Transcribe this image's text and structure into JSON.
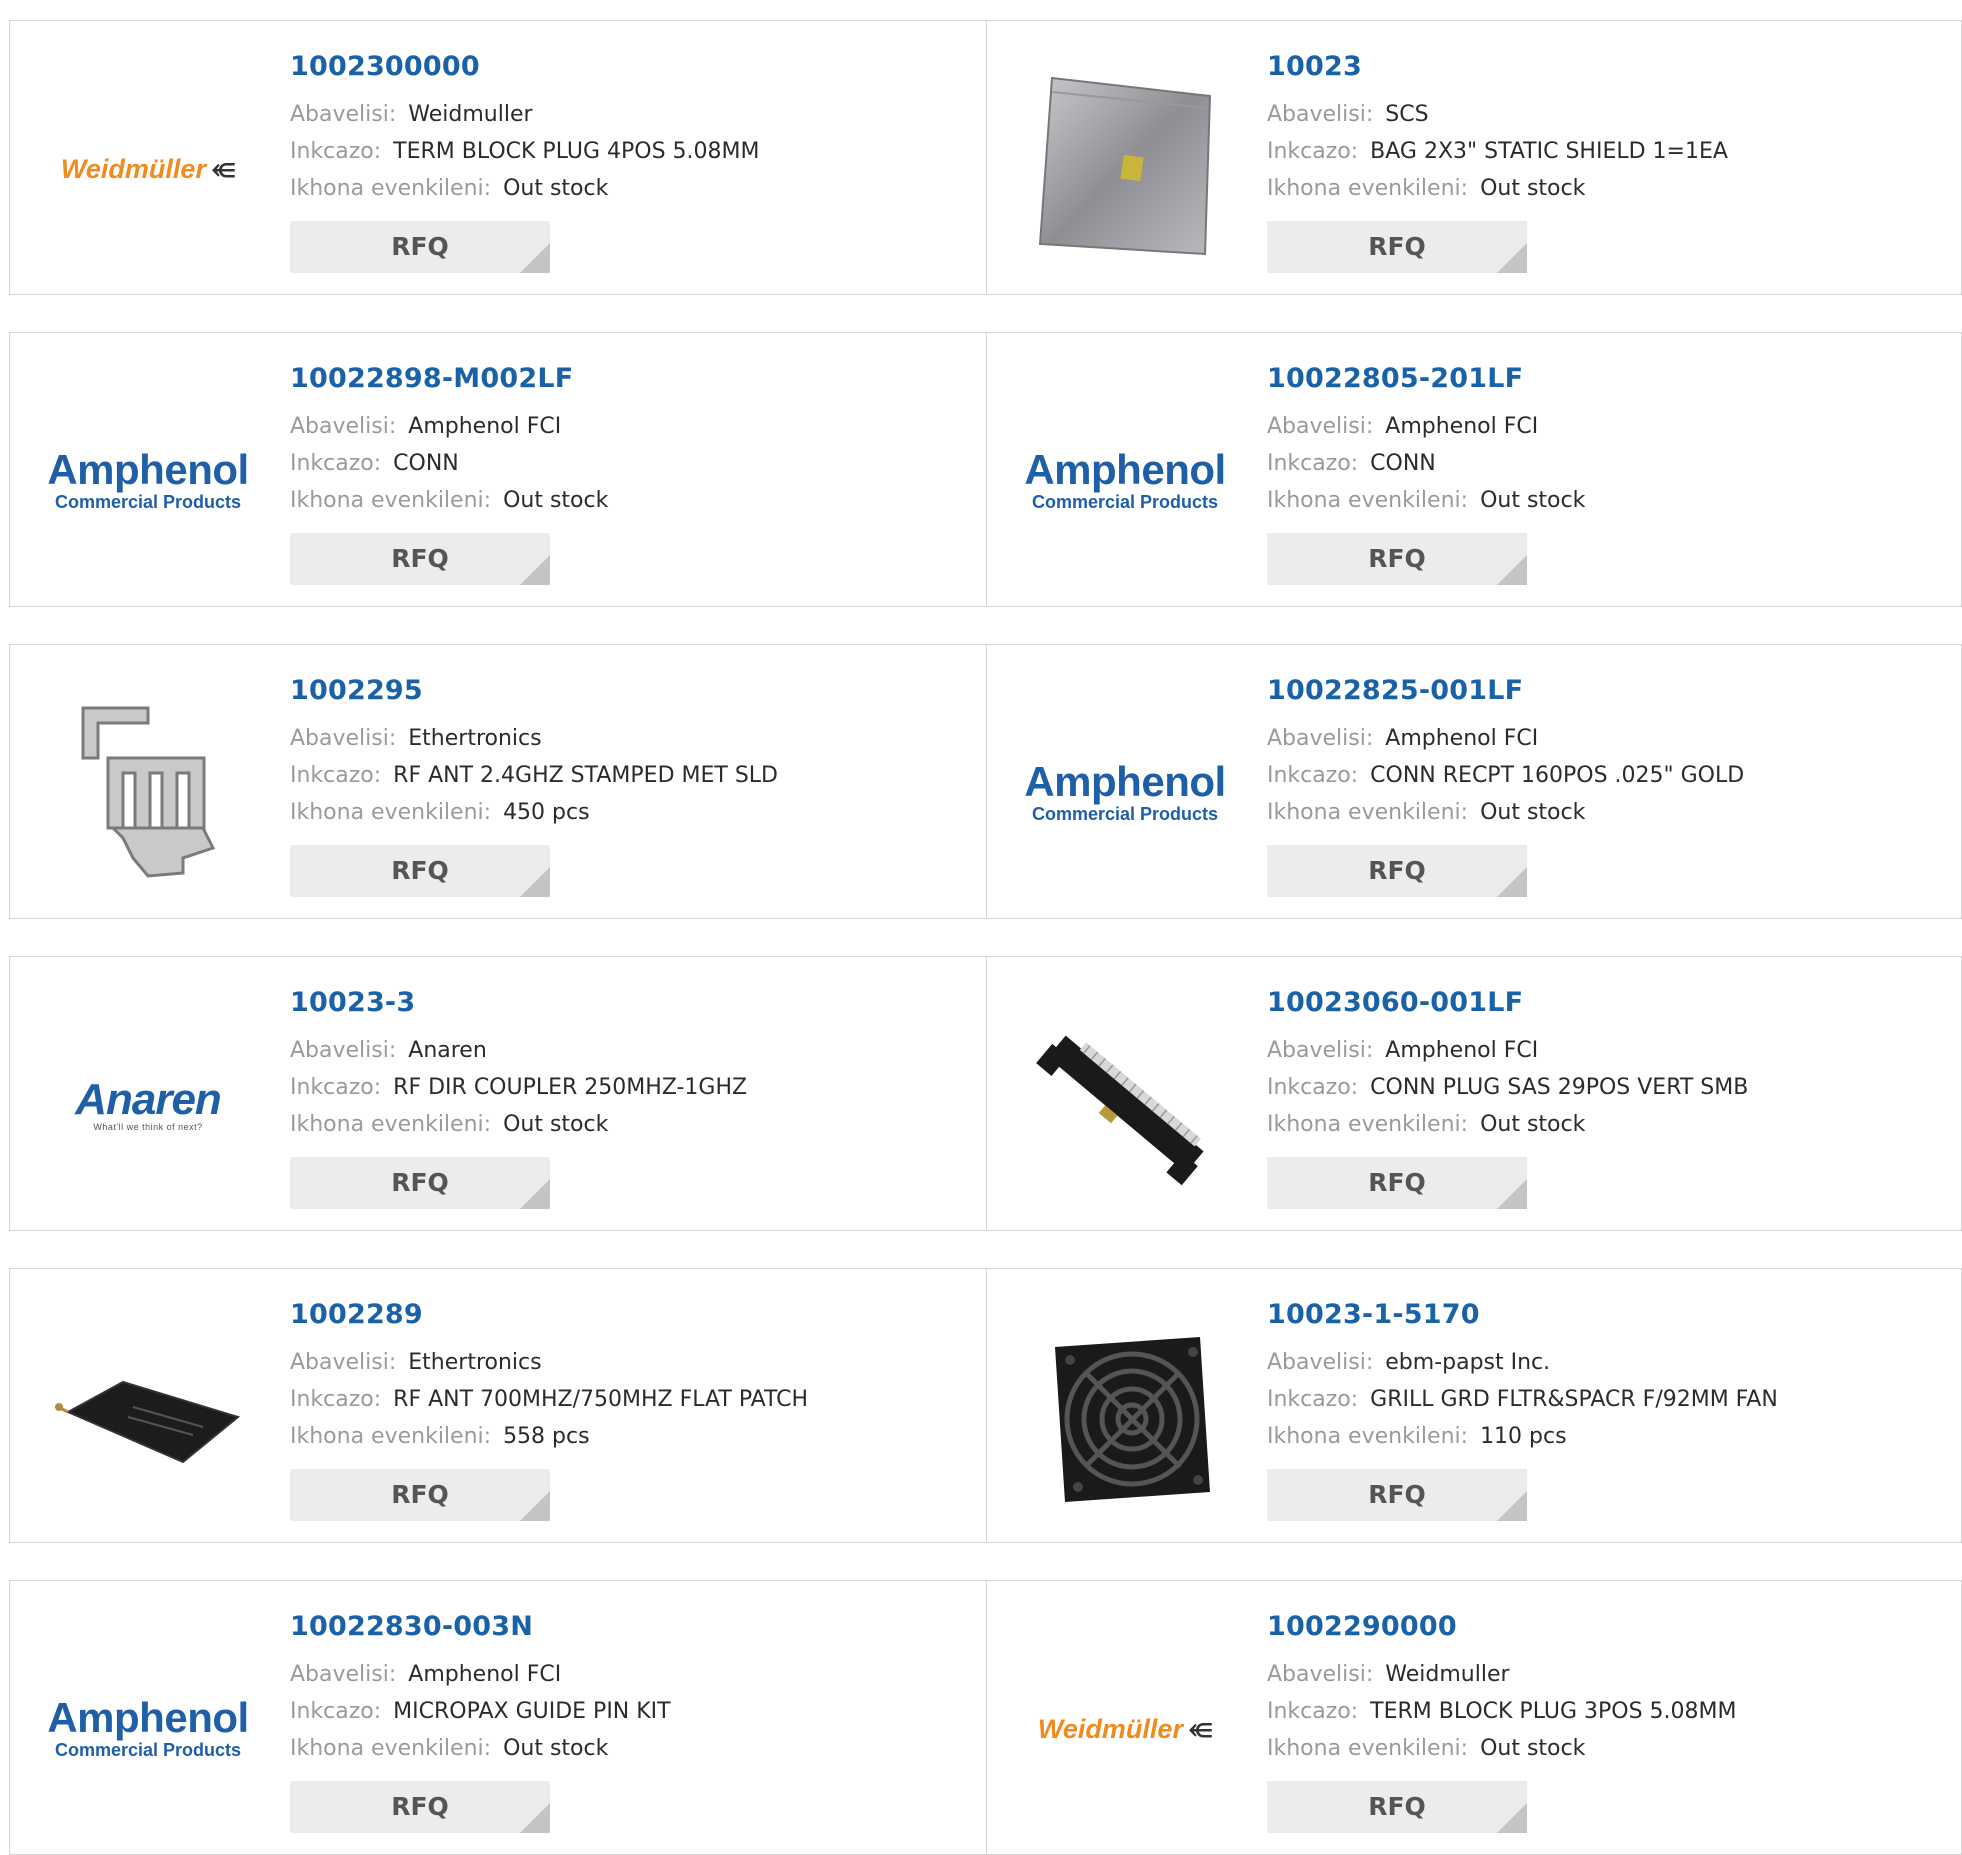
{
  "labels": {
    "manufacturer": "Abavelisi:",
    "description": "Inkcazo:",
    "stock": "Ikhona evenkileni:",
    "rfq": "RFQ"
  },
  "logos": {
    "amphenol_main": "Amphenol",
    "amphenol_sub": "Commercial Products",
    "weidmuller": "Weidmüller",
    "weidmuller_symbol": "⥺",
    "anaren_main": "Anaren",
    "anaren_sub": "What'll we think of next?"
  },
  "products": [
    {
      "part": "1002300000",
      "manufacturer": "Weidmuller",
      "description": "TERM BLOCK PLUG 4POS 5.08MM",
      "stock": "Out stock",
      "image": "weidmuller-logo"
    },
    {
      "part": "10023",
      "manufacturer": "SCS",
      "description": "BAG 2X3\" STATIC SHIELD 1=1EA",
      "stock": "Out stock",
      "image": "static-bag-photo"
    },
    {
      "part": "10022898-M002LF",
      "manufacturer": "Amphenol FCI",
      "description": "CONN",
      "stock": "Out stock",
      "image": "amphenol-logo"
    },
    {
      "part": "10022805-201LF",
      "manufacturer": "Amphenol FCI",
      "description": "CONN",
      "stock": "Out stock",
      "image": "amphenol-logo"
    },
    {
      "part": "1002295",
      "manufacturer": "Ethertronics",
      "description": "RF ANT 2.4GHZ STAMPED MET SLD",
      "stock": "450 pcs",
      "image": "stamped-antenna-photo"
    },
    {
      "part": "10022825-001LF",
      "manufacturer": "Amphenol FCI",
      "description": "CONN RECPT 160POS .025\" GOLD",
      "stock": "Out stock",
      "image": "amphenol-logo"
    },
    {
      "part": "10023-3",
      "manufacturer": "Anaren",
      "description": "RF DIR COUPLER 250MHZ-1GHZ",
      "stock": "Out stock",
      "image": "anaren-logo"
    },
    {
      "part": "10023060-001LF",
      "manufacturer": "Amphenol FCI",
      "description": "CONN PLUG SAS 29POS VERT SMB",
      "stock": "Out stock",
      "image": "sas-connector-photo"
    },
    {
      "part": "1002289",
      "manufacturer": "Ethertronics",
      "description": "RF ANT 700MHZ/750MHZ FLAT PATCH",
      "stock": "558 pcs",
      "image": "flat-patch-antenna-photo"
    },
    {
      "part": "10023-1-5170",
      "manufacturer": "ebm-papst Inc.",
      "description": "GRILL GRD FLTR&SPACR F/92MM FAN",
      "stock": "110 pcs",
      "image": "fan-grill-photo"
    },
    {
      "part": "10022830-003N",
      "manufacturer": "Amphenol FCI",
      "description": "MICROPAX GUIDE PIN KIT",
      "stock": "Out stock",
      "image": "amphenol-logo"
    },
    {
      "part": "1002290000",
      "manufacturer": "Weidmuller",
      "description": "TERM BLOCK PLUG 3POS 5.08MM",
      "stock": "Out stock",
      "image": "weidmuller-logo"
    }
  ]
}
